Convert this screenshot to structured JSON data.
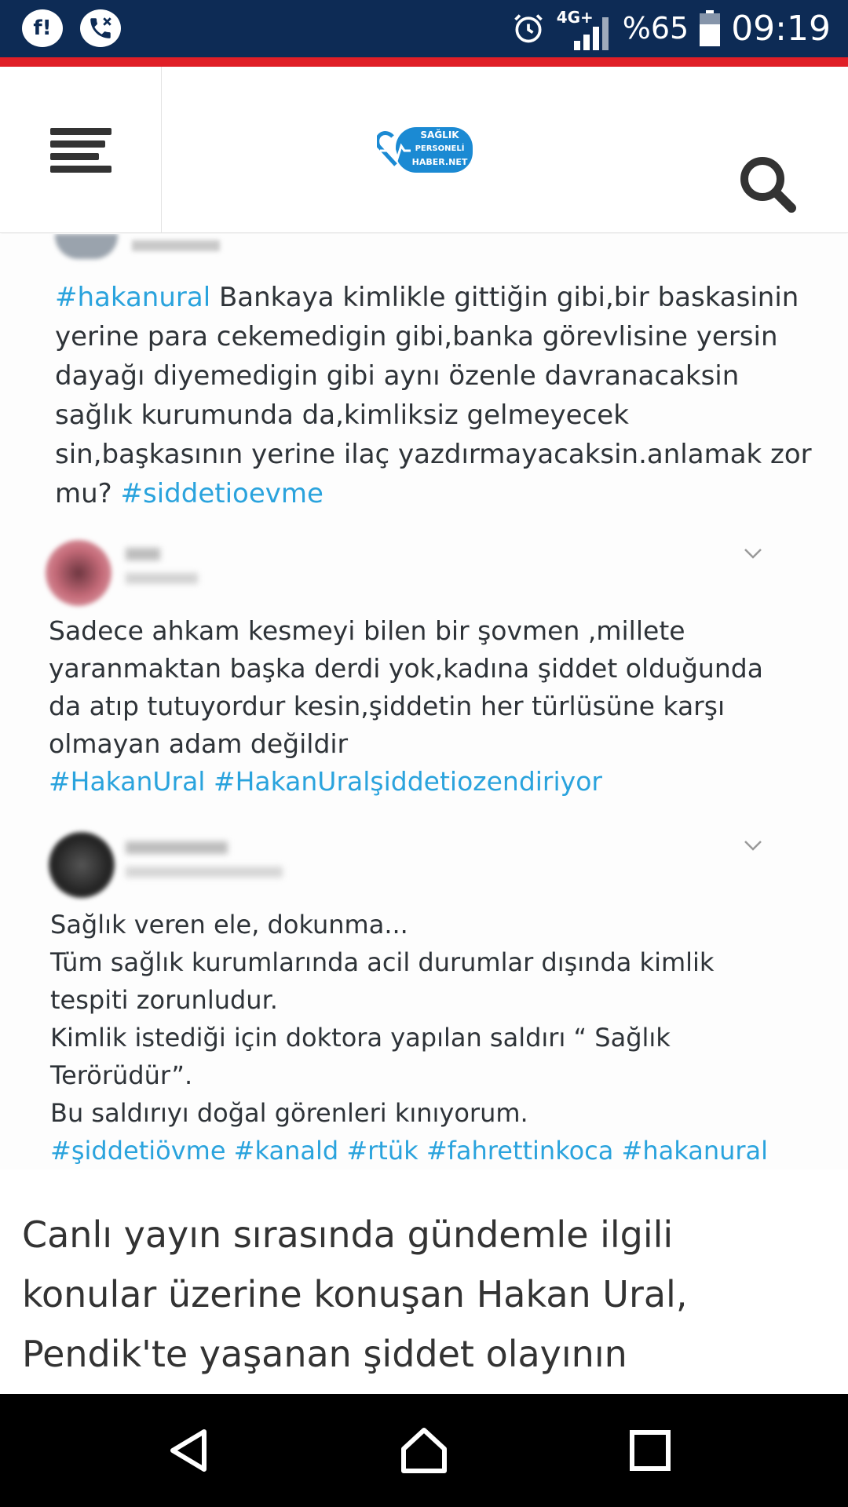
{
  "status_bar": {
    "battery": "%65",
    "time": "09:19",
    "network": "4G+"
  },
  "header": {
    "logo_lines": [
      "SAĞLIK",
      "PERSONELİ",
      "HABER.NET"
    ]
  },
  "tweets": [
    {
      "lines": [
        [
          {
            "tag": "#hakanural"
          },
          {
            "text": " Bankaya kimlikle gittiğin gibi,bir baskasinin"
          }
        ],
        [
          {
            "text": "yerine para cekemedigin gibi,banka görevlisine yersin"
          }
        ],
        [
          {
            "text": "dayağı diyemedigin gibi aynı özenle davranacaksin"
          }
        ],
        [
          {
            "text": "sağlık kurumunda da,kimliksiz gelmeyecek"
          }
        ],
        [
          {
            "text": "sin,başkasının yerine ilaç yazdırmayacaksin.anlamak zor"
          }
        ],
        [
          {
            "text": "mu? "
          },
          {
            "tag": "#siddetioevme"
          }
        ]
      ]
    },
    {
      "lines": [
        [
          {
            "text": "Sadece ahkam kesmeyi bilen bir şovmen ,millete"
          }
        ],
        [
          {
            "text": "yaranmaktan başka derdi yok,kadına şiddet olduğunda"
          }
        ],
        [
          {
            "text": "da atıp tutuyordur kesin,şiddetin her türlüsüne karşı"
          }
        ],
        [
          {
            "text": "olmayan adam değildir"
          }
        ],
        [
          {
            "tag": "#HakanUral #HakanUralşiddetiozendiriyor"
          }
        ]
      ]
    },
    {
      "lines": [
        [
          {
            "text": "Sağlık veren ele,  dokunma..."
          }
        ],
        [
          {
            "text": "Tüm sağlık kurumlarında acil durumlar dışında kimlik"
          }
        ],
        [
          {
            "text": "tespiti zorunludur."
          }
        ],
        [
          {
            "text": "Kimlik istediği için doktora yapılan saldırı “ Sağlık"
          }
        ],
        [
          {
            "text": "Terörüdür”."
          }
        ],
        [
          {
            "text": "Bu saldırıyı doğal görenleri kınıyorum."
          }
        ],
        [
          {
            "tag": "#şiddetiövme #kanald #rtük #fahrettinkoca #hakanural"
          }
        ]
      ]
    }
  ],
  "article": {
    "lines": [
      "Canlı yayın sırasında gündemle ilgili",
      "konular üzerine konuşan Hakan Ural,",
      "Pendik'te yaşanan şiddet olayının"
    ]
  },
  "colors": {
    "status_bg": "#0d2b55",
    "accent_red": "#e01f27",
    "hashtag": "#2aa3dd",
    "logo_blue": "#1b8ad3"
  },
  "icons": [
    "app-icon-f",
    "phone-missed-icon",
    "alarm-icon",
    "signal-icon",
    "battery-icon",
    "menu-icon",
    "search-icon",
    "back-icon",
    "home-icon",
    "recents-icon",
    "chevron-down-icon"
  ]
}
